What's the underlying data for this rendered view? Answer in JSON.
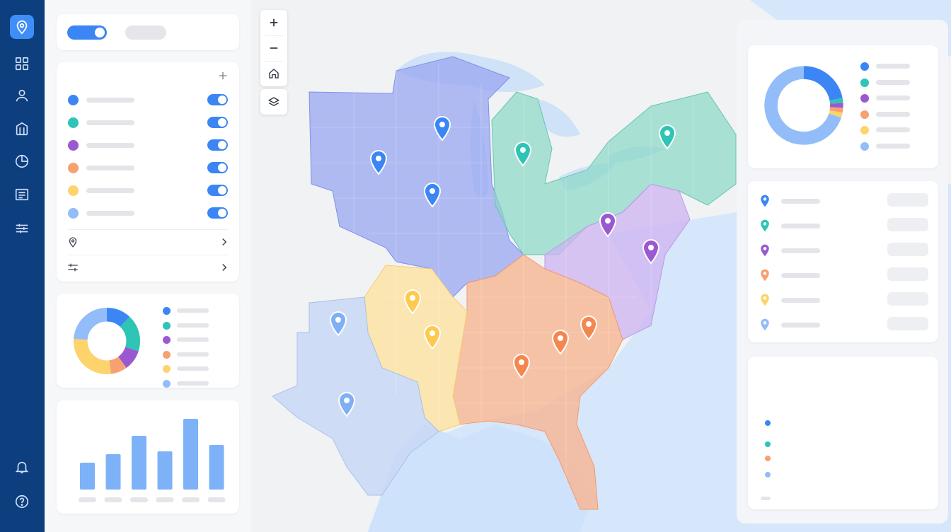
{
  "app": {
    "nav_icons": [
      "map-pin-icon",
      "grid-icon",
      "user-icon",
      "building-icon",
      "pie-chart-icon",
      "list-icon",
      "sliders-icon",
      "bell-icon",
      "help-icon"
    ]
  },
  "layers": [
    {
      "color": "#3b86f4",
      "enabled": true
    },
    {
      "color": "#2ec4b6",
      "enabled": true
    },
    {
      "color": "#9b59d0",
      "enabled": true
    },
    {
      "color": "#f7a072",
      "enabled": true
    },
    {
      "color": "#fdd36b",
      "enabled": true
    },
    {
      "color": "#92bdf8",
      "enabled": true
    }
  ],
  "region_colors": {
    "midwest": "#9aa7f2",
    "great_lakes": "#8ad9c6",
    "mid_atlantic": "#cdb3f2",
    "southeast": "#f8b592",
    "south_central": "#fde3a5",
    "southwest": "#c9d8f5"
  },
  "map_controls": {
    "zoom_in": "zoom-in",
    "zoom_out": "zoom-out",
    "home": "home",
    "layers": "layers"
  },
  "chart_data": [
    {
      "type": "pie",
      "title": "",
      "values": [
        12,
        18,
        10,
        8,
        28,
        24
      ],
      "colors": [
        "#3b86f4",
        "#2ec4b6",
        "#9b59d0",
        "#f7a072",
        "#fdd36b",
        "#92bdf8"
      ]
    },
    {
      "type": "bar",
      "title": "",
      "values": [
        38,
        50,
        76,
        54,
        100,
        63
      ],
      "color": "#7eb2f8"
    },
    {
      "type": "pie",
      "title": "",
      "values": [
        22,
        2,
        2,
        2,
        2,
        70
      ],
      "colors": [
        "#3b86f4",
        "#2ec4b6",
        "#9b59d0",
        "#f7a072",
        "#fdd36b",
        "#92bdf8"
      ]
    }
  ],
  "legend_colors": [
    "#3b86f4",
    "#2ec4b6",
    "#9b59d0",
    "#f7a072",
    "#fdd36b",
    "#92bdf8"
  ],
  "location_pins": [
    "#3b86f4",
    "#2ec4b6",
    "#9b59d0",
    "#f7a072",
    "#fdd36b",
    "#92bdf8"
  ],
  "bottom_legend_dots": [
    "#3b86f4",
    "#2ec4b6",
    "#f7a072",
    "#92bdf8"
  ]
}
